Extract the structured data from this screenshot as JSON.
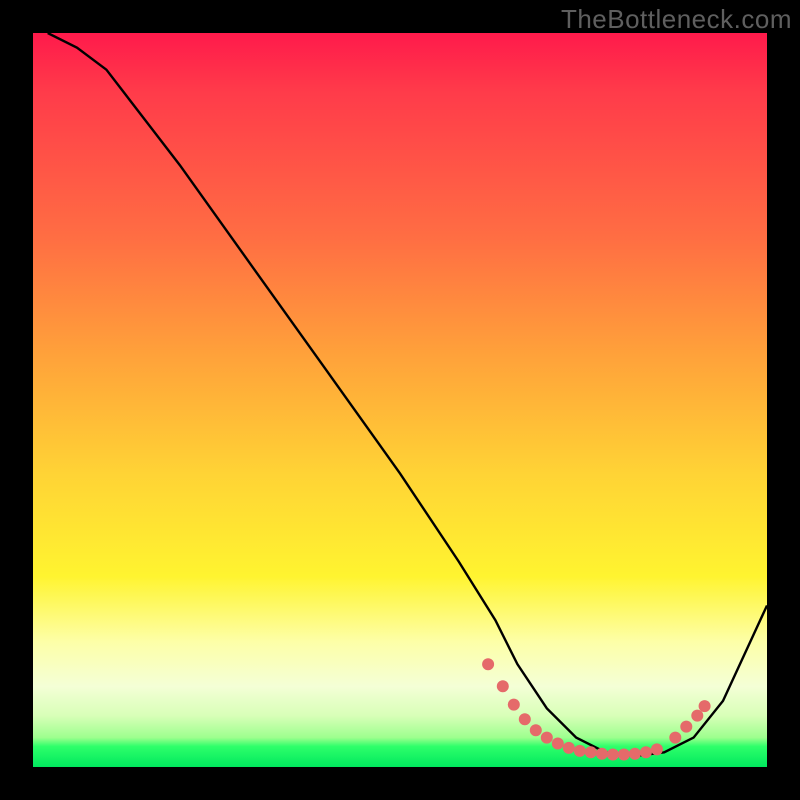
{
  "watermark": "TheBottleneck.com",
  "chart_data": {
    "type": "line",
    "title": "",
    "xlabel": "",
    "ylabel": "",
    "xlim": [
      0,
      100
    ],
    "ylim": [
      0,
      100
    ],
    "series": [
      {
        "name": "curve",
        "x": [
          2,
          6,
          10,
          20,
          30,
          40,
          50,
          58,
          63,
          66,
          70,
          74,
          78,
          82,
          86,
          90,
          94,
          100
        ],
        "y": [
          100,
          98,
          95,
          82,
          68,
          54,
          40,
          28,
          20,
          14,
          8,
          4,
          2,
          1.5,
          2,
          4,
          9,
          22
        ]
      }
    ],
    "marker_cluster": {
      "comment": "salmon dotted markers near minimum",
      "points": [
        {
          "x": 62,
          "y": 14
        },
        {
          "x": 64,
          "y": 11
        },
        {
          "x": 65.5,
          "y": 8.5
        },
        {
          "x": 67,
          "y": 6.5
        },
        {
          "x": 68.5,
          "y": 5
        },
        {
          "x": 70,
          "y": 4
        },
        {
          "x": 71.5,
          "y": 3.2
        },
        {
          "x": 73,
          "y": 2.6
        },
        {
          "x": 74.5,
          "y": 2.2
        },
        {
          "x": 76,
          "y": 2
        },
        {
          "x": 77.5,
          "y": 1.8
        },
        {
          "x": 79,
          "y": 1.7
        },
        {
          "x": 80.5,
          "y": 1.7
        },
        {
          "x": 82,
          "y": 1.8
        },
        {
          "x": 83.5,
          "y": 2
        },
        {
          "x": 85,
          "y": 2.4
        },
        {
          "x": 87.5,
          "y": 4
        },
        {
          "x": 89,
          "y": 5.5
        },
        {
          "x": 90.5,
          "y": 7
        },
        {
          "x": 91.5,
          "y": 8.3
        }
      ],
      "color": "#e56a6a",
      "radius": 6
    },
    "gradient_stops": [
      {
        "pos": 0.0,
        "color": "#ff1a4b"
      },
      {
        "pos": 0.28,
        "color": "#ff6e43"
      },
      {
        "pos": 0.6,
        "color": "#ffd335"
      },
      {
        "pos": 0.83,
        "color": "#fdffa8"
      },
      {
        "pos": 0.96,
        "color": "#9dff8e"
      },
      {
        "pos": 1.0,
        "color": "#00e85e"
      }
    ]
  }
}
